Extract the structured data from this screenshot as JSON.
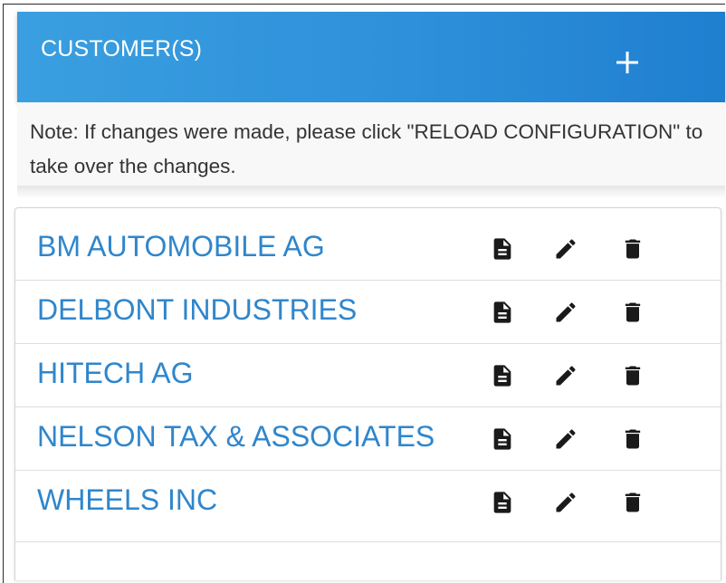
{
  "header": {
    "title": "CUSTOMER(S)",
    "add_icon": "plus-icon"
  },
  "note": {
    "text": "Note: If changes were made, please click \"RELOAD CONFIGURATION\" to take over the changes."
  },
  "customers": [
    {
      "name": "BM AUTOMOBILE AG"
    },
    {
      "name": "DELBONT INDUSTRIES"
    },
    {
      "name": "HITECH AG"
    },
    {
      "name": "NELSON TAX & ASSOCIATES"
    },
    {
      "name": "WHEELS INC"
    }
  ],
  "row_icons": [
    "document-icon",
    "pencil-icon",
    "trash-icon"
  ],
  "colors": {
    "header_start": "#3a9fe0",
    "header_end": "#1f7fd0",
    "link": "#2f86cc",
    "icon": "#1a1a1a"
  }
}
